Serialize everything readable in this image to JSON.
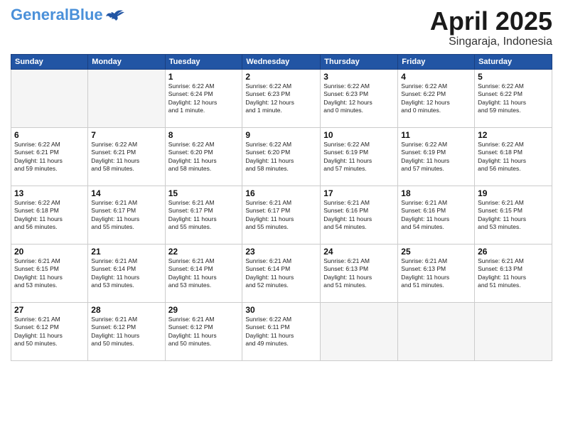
{
  "header": {
    "logo_general": "General",
    "logo_blue": "Blue",
    "title": "April 2025",
    "subtitle": "Singaraja, Indonesia"
  },
  "weekdays": [
    "Sunday",
    "Monday",
    "Tuesday",
    "Wednesday",
    "Thursday",
    "Friday",
    "Saturday"
  ],
  "weeks": [
    [
      {
        "day": "",
        "info": ""
      },
      {
        "day": "",
        "info": ""
      },
      {
        "day": "1",
        "info": "Sunrise: 6:22 AM\nSunset: 6:24 PM\nDaylight: 12 hours\nand 1 minute."
      },
      {
        "day": "2",
        "info": "Sunrise: 6:22 AM\nSunset: 6:23 PM\nDaylight: 12 hours\nand 1 minute."
      },
      {
        "day": "3",
        "info": "Sunrise: 6:22 AM\nSunset: 6:23 PM\nDaylight: 12 hours\nand 0 minutes."
      },
      {
        "day": "4",
        "info": "Sunrise: 6:22 AM\nSunset: 6:22 PM\nDaylight: 12 hours\nand 0 minutes."
      },
      {
        "day": "5",
        "info": "Sunrise: 6:22 AM\nSunset: 6:22 PM\nDaylight: 11 hours\nand 59 minutes."
      }
    ],
    [
      {
        "day": "6",
        "info": "Sunrise: 6:22 AM\nSunset: 6:21 PM\nDaylight: 11 hours\nand 59 minutes."
      },
      {
        "day": "7",
        "info": "Sunrise: 6:22 AM\nSunset: 6:21 PM\nDaylight: 11 hours\nand 58 minutes."
      },
      {
        "day": "8",
        "info": "Sunrise: 6:22 AM\nSunset: 6:20 PM\nDaylight: 11 hours\nand 58 minutes."
      },
      {
        "day": "9",
        "info": "Sunrise: 6:22 AM\nSunset: 6:20 PM\nDaylight: 11 hours\nand 58 minutes."
      },
      {
        "day": "10",
        "info": "Sunrise: 6:22 AM\nSunset: 6:19 PM\nDaylight: 11 hours\nand 57 minutes."
      },
      {
        "day": "11",
        "info": "Sunrise: 6:22 AM\nSunset: 6:19 PM\nDaylight: 11 hours\nand 57 minutes."
      },
      {
        "day": "12",
        "info": "Sunrise: 6:22 AM\nSunset: 6:18 PM\nDaylight: 11 hours\nand 56 minutes."
      }
    ],
    [
      {
        "day": "13",
        "info": "Sunrise: 6:22 AM\nSunset: 6:18 PM\nDaylight: 11 hours\nand 56 minutes."
      },
      {
        "day": "14",
        "info": "Sunrise: 6:21 AM\nSunset: 6:17 PM\nDaylight: 11 hours\nand 55 minutes."
      },
      {
        "day": "15",
        "info": "Sunrise: 6:21 AM\nSunset: 6:17 PM\nDaylight: 11 hours\nand 55 minutes."
      },
      {
        "day": "16",
        "info": "Sunrise: 6:21 AM\nSunset: 6:17 PM\nDaylight: 11 hours\nand 55 minutes."
      },
      {
        "day": "17",
        "info": "Sunrise: 6:21 AM\nSunset: 6:16 PM\nDaylight: 11 hours\nand 54 minutes."
      },
      {
        "day": "18",
        "info": "Sunrise: 6:21 AM\nSunset: 6:16 PM\nDaylight: 11 hours\nand 54 minutes."
      },
      {
        "day": "19",
        "info": "Sunrise: 6:21 AM\nSunset: 6:15 PM\nDaylight: 11 hours\nand 53 minutes."
      }
    ],
    [
      {
        "day": "20",
        "info": "Sunrise: 6:21 AM\nSunset: 6:15 PM\nDaylight: 11 hours\nand 53 minutes."
      },
      {
        "day": "21",
        "info": "Sunrise: 6:21 AM\nSunset: 6:14 PM\nDaylight: 11 hours\nand 53 minutes."
      },
      {
        "day": "22",
        "info": "Sunrise: 6:21 AM\nSunset: 6:14 PM\nDaylight: 11 hours\nand 53 minutes."
      },
      {
        "day": "23",
        "info": "Sunrise: 6:21 AM\nSunset: 6:14 PM\nDaylight: 11 hours\nand 52 minutes."
      },
      {
        "day": "24",
        "info": "Sunrise: 6:21 AM\nSunset: 6:13 PM\nDaylight: 11 hours\nand 51 minutes."
      },
      {
        "day": "25",
        "info": "Sunrise: 6:21 AM\nSunset: 6:13 PM\nDaylight: 11 hours\nand 51 minutes."
      },
      {
        "day": "26",
        "info": "Sunrise: 6:21 AM\nSunset: 6:13 PM\nDaylight: 11 hours\nand 51 minutes."
      }
    ],
    [
      {
        "day": "27",
        "info": "Sunrise: 6:21 AM\nSunset: 6:12 PM\nDaylight: 11 hours\nand 50 minutes."
      },
      {
        "day": "28",
        "info": "Sunrise: 6:21 AM\nSunset: 6:12 PM\nDaylight: 11 hours\nand 50 minutes."
      },
      {
        "day": "29",
        "info": "Sunrise: 6:21 AM\nSunset: 6:12 PM\nDaylight: 11 hours\nand 50 minutes."
      },
      {
        "day": "30",
        "info": "Sunrise: 6:22 AM\nSunset: 6:11 PM\nDaylight: 11 hours\nand 49 minutes."
      },
      {
        "day": "",
        "info": ""
      },
      {
        "day": "",
        "info": ""
      },
      {
        "day": "",
        "info": ""
      }
    ]
  ]
}
